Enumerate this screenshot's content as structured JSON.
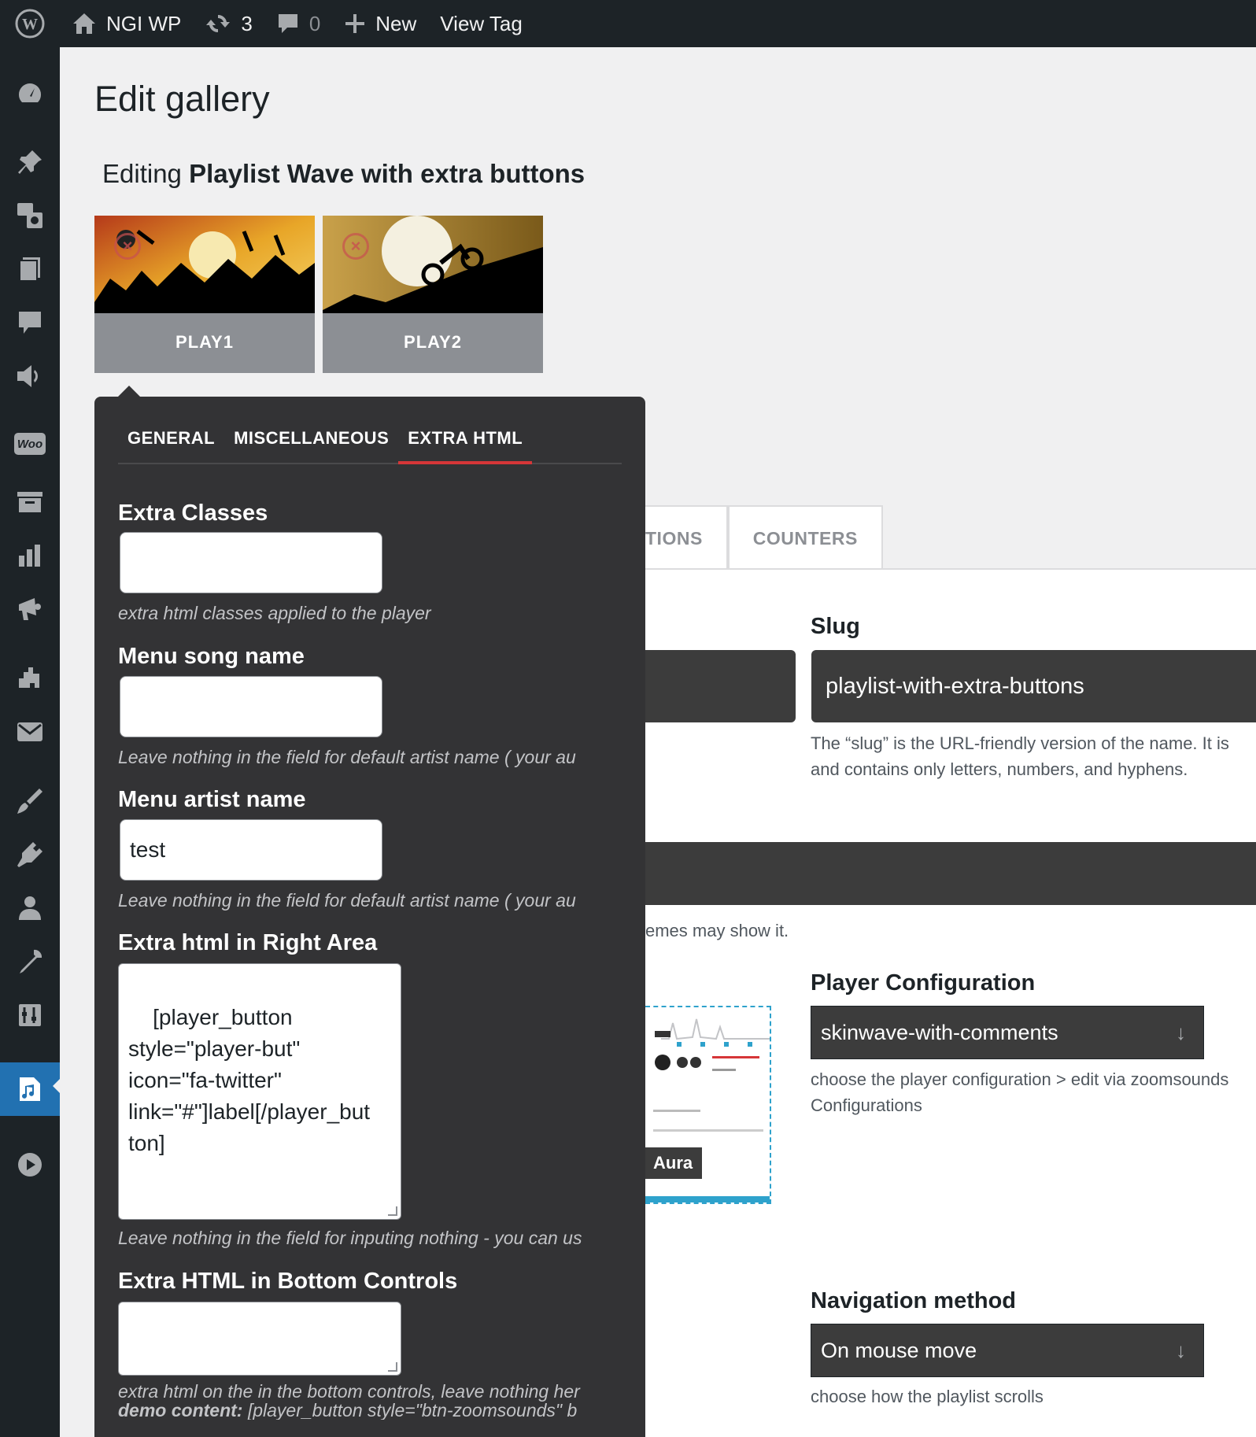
{
  "adminbar": {
    "site_name": "NGI WP",
    "updates_count": "3",
    "comments_count": "0",
    "new_label": "New",
    "view_label": "View Tag"
  },
  "sidebar": {
    "icons": [
      "dashboard-icon",
      "pin-icon",
      "media-icon",
      "pages-icon",
      "comments-icon",
      "megaphone-icon",
      "woo-icon",
      "archive-icon",
      "chart-icon",
      "marketing-icon",
      "elementor-icon",
      "mail-icon",
      "brush-icon",
      "plugin-icon",
      "users-icon",
      "tools-icon",
      "settings-icon",
      "zoomsounds-icon",
      "play-icon"
    ],
    "woo_label": "Woo"
  },
  "page": {
    "title": "Edit gallery",
    "editing_prefix": "Editing",
    "gallery_name": "Playlist Wave with extra buttons"
  },
  "thumbs": [
    {
      "label": "PLAY1"
    },
    {
      "label": "PLAY2"
    }
  ],
  "overlay": {
    "tabs": [
      "GENERAL",
      "MISCELLANEOUS",
      "EXTRA HTML"
    ],
    "active_tab": "EXTRA HTML",
    "fields": {
      "extra_classes": {
        "label": "Extra Classes",
        "value": "",
        "help": "extra html classes applied to the player"
      },
      "menu_song_name": {
        "label": "Menu song name",
        "value": "",
        "help": "Leave nothing in the field for default artist name ( your au"
      },
      "menu_artist_name": {
        "label": "Menu artist name",
        "value": "test",
        "help": "Leave nothing in the field for default artist name ( your au"
      },
      "extra_html_right": {
        "label": "Extra html in Right Area",
        "value": "[player_button\nstyle=\"player-but\"\nicon=\"fa-twitter\"\nlink=\"#\"]label[/player_but\nton]",
        "help": "Leave nothing in the field for inputing nothing - you can us"
      },
      "extra_html_bottom": {
        "label": "Extra HTML in Bottom Controls",
        "value": "",
        "help": "extra html on the in the bottom controls, leave nothing her",
        "demo_prefix": "demo content:",
        "demo_text": " [player_button style=\"btn-zoomsounds\" b"
      }
    }
  },
  "background": {
    "tabs": [
      "TIONS",
      "COUNTERS"
    ],
    "slug": {
      "label": "Slug",
      "value": "playlist-with-extra-buttons",
      "desc_line1": "The “slug” is the URL-friendly version of the name. It is",
      "desc_line2": "and contains only letters, numbers, and hyphens."
    },
    "themes_text": "emes may show it.",
    "preview_label": "Aura",
    "player_config": {
      "label": "Player Configuration",
      "value": "skinwave-with-comments",
      "desc_line1": "choose the player configuration > edit via zoomsounds",
      "desc_line2": "Configurations"
    },
    "navigation": {
      "label": "Navigation method",
      "value": "On mouse move",
      "desc": "choose how the playlist scrolls"
    }
  },
  "colors": {
    "adminbar_bg": "#1d2327",
    "accent": "#2271b1",
    "active_tab_underline": "#d63638",
    "overlay_bg": "#333335"
  }
}
